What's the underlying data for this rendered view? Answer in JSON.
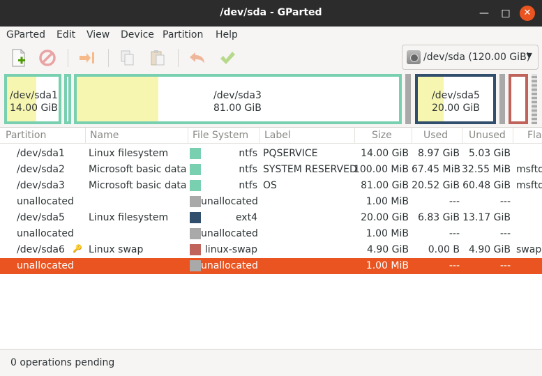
{
  "window": {
    "title": "/dev/sda - GParted"
  },
  "menu": [
    "GParted",
    "Edit",
    "View",
    "Device",
    "Partition",
    "Help"
  ],
  "toolbar": {
    "icons": [
      "new-icon",
      "delete-icon",
      "resize-move-icon",
      "copy-icon",
      "paste-icon",
      "undo-icon",
      "apply-icon"
    ],
    "device": "/dev/sda (120.00 GiB)"
  },
  "visual": {
    "sda1": {
      "name": "/dev/sda1",
      "size": "14.00 GiB"
    },
    "sda3": {
      "name": "/dev/sda3",
      "size": "81.00 GiB"
    },
    "sda5": {
      "name": "/dev/sda5",
      "size": "20.00 GiB"
    }
  },
  "colors": {
    "ntfs": "#78d0b0",
    "ext4": "#314e6c",
    "linux-swap": "#c0635b",
    "unallocated": "#a9a9a9",
    "used_fill": "#f7f6b1",
    "selection": "#e95420"
  },
  "table": {
    "headers": [
      "Partition",
      "Name",
      "File System",
      "Label",
      "Size",
      "Used",
      "Unused",
      "Flag"
    ],
    "rows": [
      {
        "partition": "/dev/sda1",
        "name": "Linux filesystem",
        "fs": "ntfs",
        "label": "PQSERVICE",
        "size": "14.00 GiB",
        "used": "8.97 GiB",
        "unused": "5.03 GiB",
        "flags": ""
      },
      {
        "partition": "/dev/sda2",
        "name": "Microsoft basic data",
        "fs": "ntfs",
        "label": "SYSTEM RESERVED",
        "size": "100.00 MiB",
        "used": "67.45 MiB",
        "unused": "32.55 MiB",
        "flags": "msftd"
      },
      {
        "partition": "/dev/sda3",
        "name": "Microsoft basic data",
        "fs": "ntfs",
        "label": "OS",
        "size": "81.00 GiB",
        "used": "20.52 GiB",
        "unused": "60.48 GiB",
        "flags": "msftd"
      },
      {
        "partition": "unallocated",
        "name": "",
        "fs": "unallocated",
        "label": "",
        "size": "1.00 MiB",
        "used": "---",
        "unused": "---",
        "flags": ""
      },
      {
        "partition": "/dev/sda5",
        "name": "Linux filesystem",
        "fs": "ext4",
        "label": "",
        "size": "20.00 GiB",
        "used": "6.83 GiB",
        "unused": "13.17 GiB",
        "flags": ""
      },
      {
        "partition": "unallocated",
        "name": "",
        "fs": "unallocated",
        "label": "",
        "size": "1.00 MiB",
        "used": "---",
        "unused": "---",
        "flags": ""
      },
      {
        "partition": "/dev/sda6",
        "name": "Linux swap",
        "fs": "linux-swap",
        "label": "",
        "size": "4.90 GiB",
        "used": "0.00 B",
        "unused": "4.90 GiB",
        "flags": "swap"
      },
      {
        "partition": "unallocated",
        "name": "",
        "fs": "unallocated",
        "label": "",
        "size": "1.00 MiB",
        "used": "---",
        "unused": "---",
        "flags": ""
      }
    ]
  },
  "status": "0 operations pending"
}
